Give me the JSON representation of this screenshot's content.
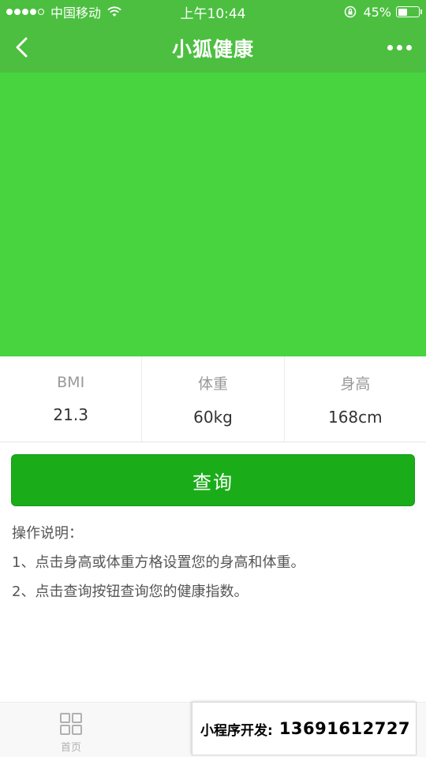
{
  "status_bar": {
    "carrier": "中国移动",
    "time": "上午10:44",
    "battery": "45%",
    "battery_level": 0.45
  },
  "nav": {
    "title": "小狐健康",
    "back_icon": "chevron-left-icon",
    "more_icon": "more-dots-icon"
  },
  "theme": {
    "nav_color": "#4cbf40",
    "chart_color": "#48d43f",
    "button_color": "#1aad19"
  },
  "stats": [
    {
      "label": "BMI",
      "value": "21.3"
    },
    {
      "label": "体重",
      "value": "60kg"
    },
    {
      "label": "身高",
      "value": "168cm"
    }
  ],
  "query_button": {
    "label": "查询"
  },
  "instructions": {
    "title": "操作说明：",
    "lines": [
      "1、点击身高或体重方格设置您的身高和体重。",
      "2、点击查询按钮查询您的健康指数。"
    ]
  },
  "tab_bar": {
    "items": [
      {
        "label": "首页",
        "icon": "grid-icon"
      }
    ]
  },
  "watermark": {
    "label": "小程序开发:",
    "phone": "13691612727"
  }
}
